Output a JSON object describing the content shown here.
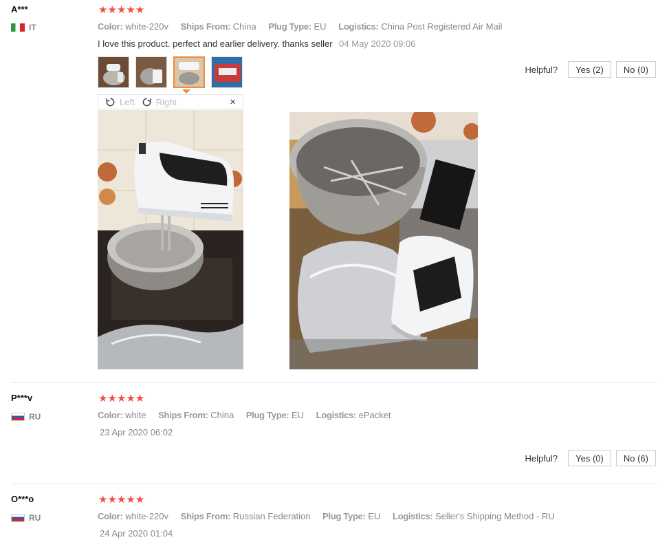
{
  "reviews": [
    {
      "user": "A***",
      "country": "IT",
      "stars": "★★★★★",
      "props": [
        {
          "k": "Color:",
          "v": "white-220v"
        },
        {
          "k": "Ships From:",
          "v": "China"
        },
        {
          "k": "Plug Type:",
          "v": "EU"
        },
        {
          "k": "Logistics:",
          "v": "China Post Registered Air Mail"
        }
      ],
      "text": "I love this product. perfect and earlier delivery. thanks seller",
      "date": "04 May 2020 09:06",
      "helpful_label": "Helpful?",
      "yes": "Yes (2)",
      "no": "No (0)",
      "viewer": {
        "left": "Left",
        "right": "Right",
        "close": "×"
      }
    },
    {
      "user": "P***v",
      "country": "RU",
      "stars": "★★★★★",
      "props": [
        {
          "k": "Color:",
          "v": "white"
        },
        {
          "k": "Ships From:",
          "v": "China"
        },
        {
          "k": "Plug Type:",
          "v": "EU"
        },
        {
          "k": "Logistics:",
          "v": "ePacket"
        }
      ],
      "date": "23 Apr 2020 06:02",
      "helpful_label": "Helpful?",
      "yes": "Yes (0)",
      "no": "No (6)"
    },
    {
      "user": "O***o",
      "country": "RU",
      "stars": "★★★★★",
      "props": [
        {
          "k": "Color:",
          "v": "white-220v"
        },
        {
          "k": "Ships From:",
          "v": "Russian Federation"
        },
        {
          "k": "Plug Type:",
          "v": "EU"
        },
        {
          "k": "Logistics:",
          "v": "Seller's Shipping Method - RU"
        }
      ],
      "date": "24 Apr 2020 01:04"
    }
  ],
  "colors": {
    "star": "#f44b3c",
    "active_thumb": "#f08a3c"
  }
}
